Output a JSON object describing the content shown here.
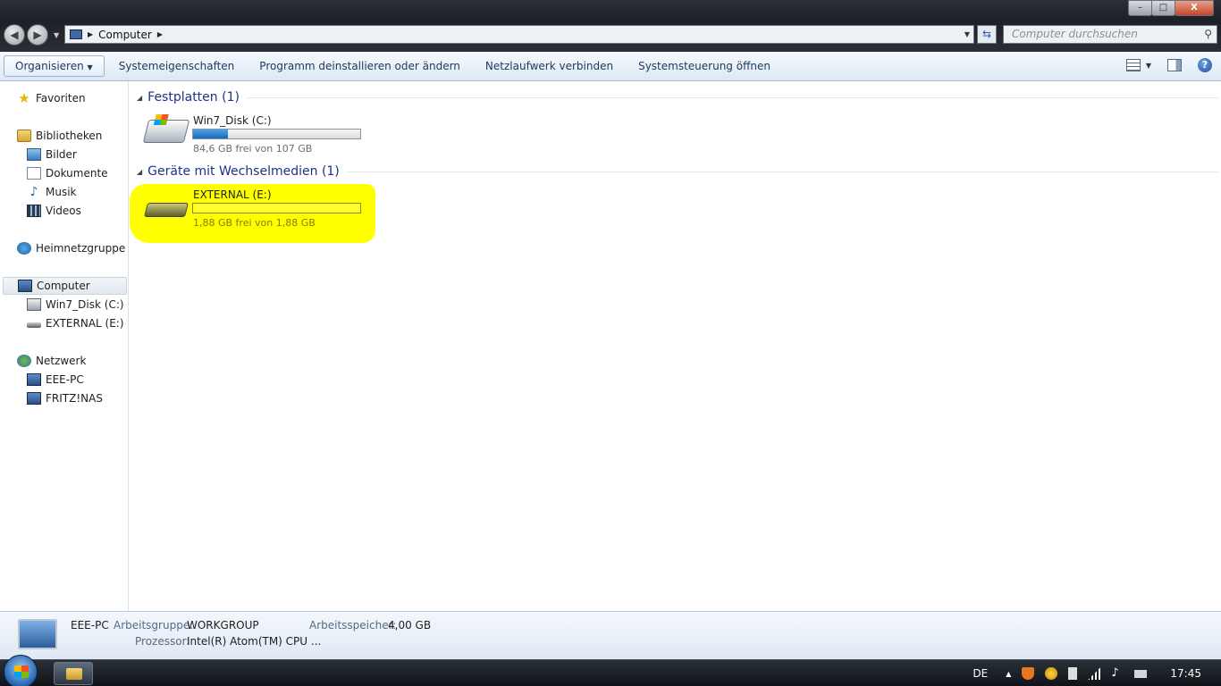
{
  "window": {
    "controls": [
      "–",
      "□",
      "X"
    ]
  },
  "address": {
    "crumb": "Computer",
    "search_placeholder": "Computer durchsuchen"
  },
  "toolbar": {
    "organize": "Organisieren",
    "system_properties": "Systemeigenschaften",
    "uninstall": "Programm deinstallieren oder ändern",
    "map_drive": "Netzlaufwerk verbinden",
    "control_panel": "Systemsteuerung öffnen"
  },
  "nav": {
    "favorites": "Favoriten",
    "libraries": "Bibliotheken",
    "pictures": "Bilder",
    "documents": "Dokumente",
    "music": "Musik",
    "videos": "Videos",
    "homegroup": "Heimnetzgruppe",
    "computer": "Computer",
    "drive_c": "Win7_Disk (C:)",
    "drive_e": "EXTERNAL (E:)",
    "network": "Netzwerk",
    "net_eee": "EEE-PC",
    "net_fritz": "FRITZ!NAS"
  },
  "groups": {
    "hdd_title": "Festplatten (1)",
    "removable_title": "Geräte mit Wechselmedien (1)"
  },
  "drives": [
    {
      "name": "Win7_Disk (C:)",
      "free_text": "84,6 GB frei von 107 GB",
      "used_fraction": 0.21,
      "icon": "hard-disk-icon"
    },
    {
      "name": "EXTERNAL (E:)",
      "free_text": "1,88 GB frei von 1,88 GB",
      "used_fraction": 0.0,
      "icon": "removable-drive-icon"
    }
  ],
  "details": {
    "pc_name": "EEE-PC",
    "workgroup_label": "Arbeitsgruppe:",
    "workgroup_value": "WORKGROUP",
    "memory_label": "Arbeitsspeicher:",
    "memory_value": "4,00 GB",
    "cpu_label": "Prozessor:",
    "cpu_value": "Intel(R) Atom(TM) CPU ..."
  },
  "taskbar": {
    "language": "DE",
    "clock": "17:45"
  },
  "colors": {
    "highlight": "#ffff00",
    "group_title": "#1e3287",
    "bar_fill": "#1a66b8"
  }
}
